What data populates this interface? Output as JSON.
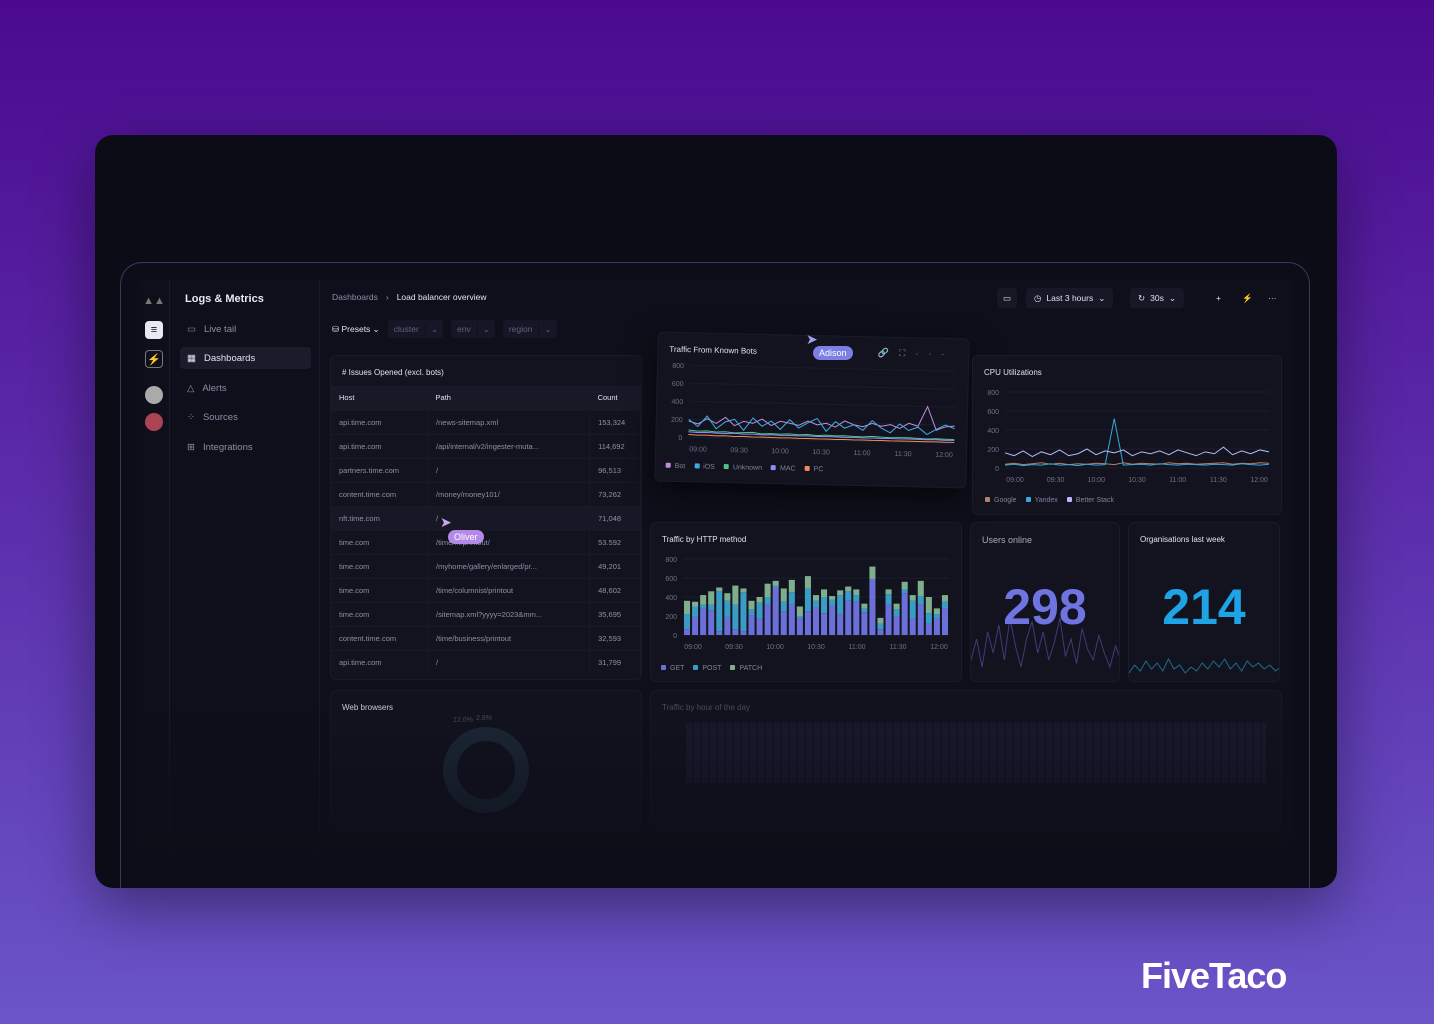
{
  "brand": "FiveTaco",
  "sidebar": {
    "title": "Logs & Metrics",
    "items": [
      {
        "label": "Live tail",
        "icon": "terminal-icon"
      },
      {
        "label": "Dashboards",
        "icon": "chart-icon",
        "active": true
      },
      {
        "label": "Alerts",
        "icon": "warning-icon"
      },
      {
        "label": "Sources",
        "icon": "sources-icon"
      },
      {
        "label": "Integrations",
        "icon": "integrations-icon"
      }
    ]
  },
  "breadcrumb": {
    "parent": "Dashboards",
    "current": "Load balancer overview"
  },
  "toolbar": {
    "time_range": "Last 3 hours",
    "refresh": "30s"
  },
  "filters": {
    "presets": "Presets",
    "items": [
      "cluster",
      "env",
      "region"
    ]
  },
  "issues": {
    "title": "# Issues Opened (excl. bots)",
    "columns": [
      "Host",
      "Path",
      "Count"
    ],
    "rows": [
      [
        "api.time.com",
        "/news-sitemap.xml",
        "153,324"
      ],
      [
        "api.time.com",
        "/api/internal/v2/ingester-muta...",
        "114,692"
      ],
      [
        "partners.time.com",
        "/",
        "96,513"
      ],
      [
        "content.time.com",
        "/money/money101/",
        "73,262"
      ],
      [
        "nft.time.com",
        "/",
        "71,048"
      ],
      [
        "time.com",
        "/time/.../printout/",
        "53.592"
      ],
      [
        "time.com",
        "/myhome/gallery/enlarged/pr...",
        "49,201"
      ],
      [
        "time.com",
        "/time/columnist/printout",
        "48,602"
      ],
      [
        "time.com",
        "/sitemap.xml?yyyy=2023&mm...",
        "35,695"
      ],
      [
        "content.time.com",
        "/time/business/printout",
        "32,593"
      ],
      [
        "api.time.com",
        "/",
        "31,799"
      ]
    ]
  },
  "cursors": [
    {
      "name": "Adison",
      "color": "#7b7fe6"
    },
    {
      "name": "Oliver",
      "color": "#b48ae8"
    }
  ],
  "chart_data": [
    {
      "type": "line",
      "title": "Traffic From Known Bots",
      "ylim": [
        0,
        800
      ],
      "yticks": [
        0,
        200,
        400,
        600,
        800
      ],
      "xticks": [
        "09:00",
        "09:30",
        "10:00",
        "10:30",
        "11:00",
        "11:30",
        "12:00"
      ],
      "legend": "bottom",
      "series": [
        {
          "name": "Bot",
          "color": "#c58ae0",
          "values": [
            180,
            150,
            210,
            160,
            230,
            140,
            190,
            170,
            220,
            150,
            200,
            180,
            160,
            210,
            170,
            190,
            150,
            220,
            180,
            160,
            200,
            170,
            190,
            150,
            210,
            180,
            400,
            140,
            180,
            190
          ]
        },
        {
          "name": "iOS",
          "color": "#3ab0e0",
          "values": [
            200,
            120,
            240,
            100,
            180,
            210,
            90,
            230,
            140,
            200,
            110,
            220,
            130,
            190,
            240,
            100,
            210,
            140,
            180,
            120,
            230,
            150,
            100,
            200,
            130,
            170,
            90,
            150,
            200,
            160
          ]
        },
        {
          "name": "Unknown",
          "color": "#4fc38a",
          "values": [
            80,
            70,
            75,
            65,
            70,
            60,
            65,
            70,
            55,
            60,
            58,
            62,
            55,
            60,
            50,
            58,
            52,
            55,
            50,
            48,
            55,
            50,
            45,
            48,
            50,
            45,
            40,
            45,
            42,
            40
          ]
        },
        {
          "name": "MAC",
          "color": "#8e8ff0",
          "values": [
            60,
            55,
            58,
            52,
            50,
            55,
            48,
            50,
            45,
            48,
            44,
            46,
            42,
            45,
            40,
            42,
            40,
            38,
            40,
            36,
            38,
            35,
            36,
            34,
            35,
            33,
            32,
            34,
            30,
            32
          ]
        },
        {
          "name": "PC",
          "color": "#f08a5a",
          "values": [
            30,
            25,
            28,
            22,
            25,
            20,
            22,
            18,
            20,
            18,
            16,
            18,
            15,
            16,
            14,
            15,
            12,
            14,
            12,
            13,
            11,
            12,
            10,
            11,
            10,
            10,
            9,
            10,
            8,
            9
          ]
        }
      ]
    },
    {
      "type": "line",
      "title": "CPU Utilizations",
      "ylim": [
        0,
        800
      ],
      "yticks": [
        0,
        200,
        400,
        600,
        800
      ],
      "xticks": [
        "09:00",
        "09:30",
        "10:00",
        "10:30",
        "11:00",
        "11:30",
        "12:00"
      ],
      "legend": "bottom",
      "series": [
        {
          "name": "Google",
          "color": "#b0806a",
          "values": [
            40,
            50,
            35,
            45,
            55,
            40,
            50,
            35,
            45,
            40,
            50,
            45,
            35,
            55,
            40,
            50,
            45,
            40,
            55,
            45,
            50,
            40,
            45,
            50,
            55,
            40,
            50,
            45,
            55,
            50
          ]
        },
        {
          "name": "Yandex",
          "color": "#3aa8d8",
          "values": [
            30,
            40,
            25,
            35,
            30,
            45,
            30,
            35,
            25,
            40,
            30,
            35,
            520,
            30,
            35,
            40,
            30,
            45,
            35,
            30,
            40,
            35,
            30,
            40,
            35,
            30,
            45,
            35,
            30,
            40
          ]
        },
        {
          "name": "Better Stack",
          "color": "#b8baf5",
          "values": [
            160,
            130,
            180,
            120,
            170,
            140,
            190,
            130,
            150,
            200,
            140,
            180,
            160,
            190,
            130,
            170,
            150,
            180,
            140,
            190,
            160,
            130,
            170,
            150,
            220,
            140,
            180,
            150,
            190,
            170
          ]
        }
      ]
    },
    {
      "type": "bar",
      "stacked": true,
      "title": "Traffic by HTTP method",
      "ylim": [
        0,
        800
      ],
      "yticks": [
        0,
        200,
        400,
        600,
        800
      ],
      "xticks": [
        "09:00",
        "09:30",
        "10:00",
        "10:30",
        "11:00",
        "11:30",
        "12:00"
      ],
      "legend": "bottom",
      "series": [
        {
          "name": "GET",
          "color": "#6b6fd8",
          "values": [
            60,
            190,
            280,
            260,
            40,
            190,
            60,
            40,
            210,
            170,
            320,
            500,
            250,
            320,
            180,
            250,
            290,
            230,
            310,
            220,
            360,
            350,
            240,
            590,
            60,
            320,
            200,
            440,
            170,
            320,
            120,
            180,
            280
          ]
        },
        {
          "name": "POST",
          "color": "#3a9cc4",
          "values": [
            160,
            110,
            40,
            60,
            420,
            170,
            260,
            410,
            60,
            170,
            80,
            20,
            100,
            130,
            20,
            240,
            70,
            170,
            60,
            200,
            100,
            70,
            40,
            0,
            60,
            110,
            70,
            40,
            190,
            90,
            110,
            40,
            70
          ]
        },
        {
          "name": "PATCH",
          "color": "#7fae8c",
          "values": [
            140,
            50,
            100,
            140,
            40,
            80,
            200,
            40,
            90,
            60,
            140,
            50,
            140,
            130,
            100,
            130,
            60,
            80,
            40,
            50,
            50,
            60,
            50,
            130,
            60,
            50,
            60,
            80,
            60,
            160,
            170,
            60,
            70
          ]
        }
      ]
    }
  ],
  "stats": [
    {
      "title": "Users online",
      "value": "298",
      "color": "#7074e0",
      "sparkline": [
        30,
        60,
        20,
        70,
        40,
        80,
        30,
        90,
        50,
        20,
        60,
        85,
        40,
        70,
        30,
        55,
        90,
        35,
        60,
        25,
        75,
        45,
        30,
        65,
        40,
        20,
        50,
        30
      ]
    },
    {
      "title": "Organisations last week",
      "value": "214",
      "color": "#1ea3e6",
      "sparkline": [
        20,
        40,
        25,
        50,
        30,
        45,
        25,
        55,
        30,
        40,
        20,
        35,
        25,
        45,
        30,
        50,
        35,
        55,
        30,
        45,
        25,
        50,
        35,
        45,
        30,
        40,
        25,
        35
      ]
    }
  ],
  "web_browsers": {
    "title": "Web browsers",
    "labels": [
      "12.0%",
      "2.8%"
    ]
  },
  "traffic_hour": {
    "title": "Traffic by hour of the day"
  }
}
